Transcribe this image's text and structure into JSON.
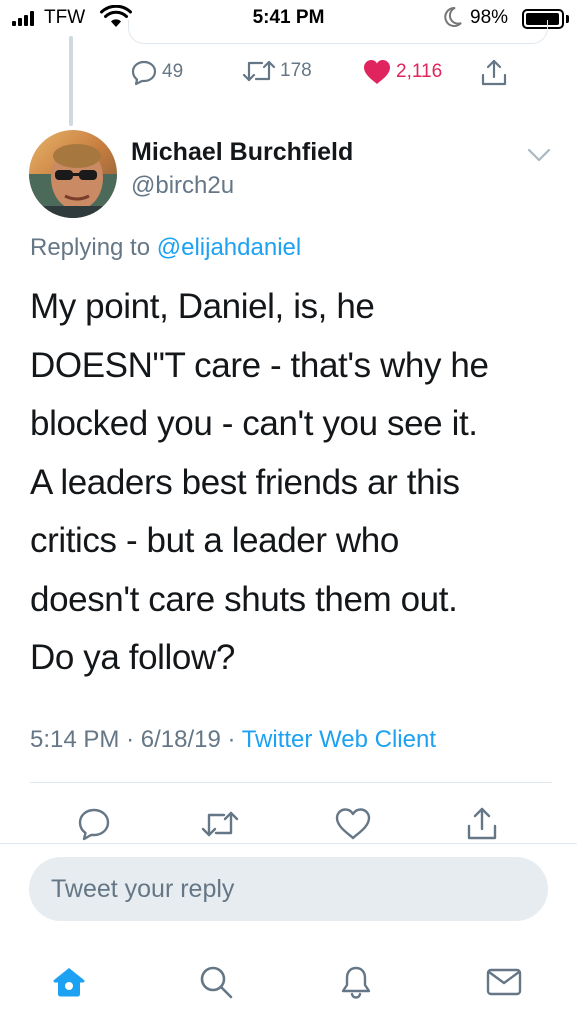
{
  "status_bar": {
    "carrier": "TFW",
    "time": "5:41 PM",
    "battery_percent": "98%",
    "battery_level": 0.98,
    "icons": [
      "signal-icon",
      "wifi-icon",
      "do-not-disturb-moon-icon",
      "battery-icon"
    ]
  },
  "previous_tweet": {
    "replies": "49",
    "retweets": "178",
    "likes": "2,116",
    "liked": true,
    "like_color": "#e0245e"
  },
  "tweet": {
    "display_name": "Michael Burchfield",
    "handle": "@birch2u",
    "replying_prefix": "Replying to",
    "replying_to": "@elijahdaniel",
    "text_lines": [
      "My point, Daniel, is, he",
      "DOESN\"T care - that's why he",
      "blocked you - can't you see it.",
      "A leaders best friends ar this",
      "critics - but a leader who",
      "doesn't care shuts them out.",
      "Do ya follow?"
    ],
    "time": "5:14 PM",
    "date": "6/18/19",
    "separator": "·",
    "client": "Twitter Web Client"
  },
  "actions": [
    "reply-icon",
    "retweet-icon",
    "like-icon",
    "share-icon"
  ],
  "reply_box": {
    "placeholder": "Tweet your reply"
  },
  "tabbar": {
    "tabs": [
      "home-icon",
      "search-icon",
      "notifications-icon",
      "messages-icon"
    ],
    "active": "home-icon"
  },
  "colors": {
    "accent": "#1da1f2",
    "secondary_text": "#657786",
    "primary_text": "#14171a",
    "like": "#e0245e"
  }
}
